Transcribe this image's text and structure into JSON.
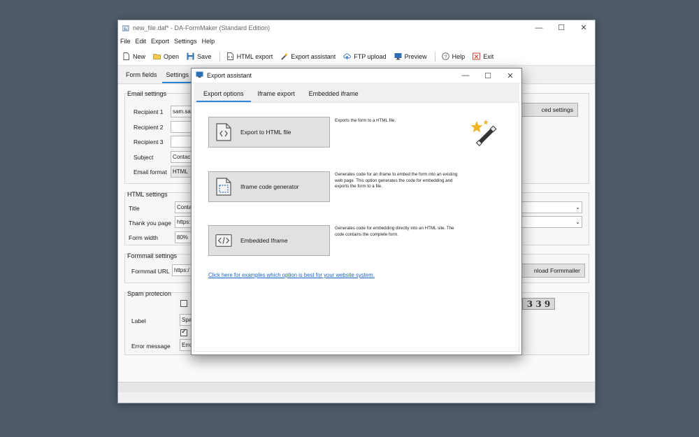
{
  "window": {
    "title": "new_file.daf* - DA-FormMaker (Standard Edition)",
    "minimize": "—",
    "maximize": "☐",
    "close": "✕"
  },
  "menu": [
    "File",
    "Edit",
    "Export",
    "Settings",
    "Help"
  ],
  "toolbar": {
    "new": "New",
    "open": "Open",
    "save": "Save",
    "html_export": "HTML export",
    "export_assistant": "Export assistant",
    "ftp_upload": "FTP upload",
    "preview": "Preview",
    "help": "Help",
    "exit": "Exit"
  },
  "main_tabs": [
    "Form fields",
    "Settings"
  ],
  "email_settings": {
    "title": "Email settings",
    "recipient1_label": "Recipient 1",
    "recipient1_value": "sam.sa",
    "recipient2_label": "Recipient 2",
    "recipient3_label": "Recipient 3",
    "subject_label": "Subject",
    "subject_value": "Contac",
    "format_label": "Email format",
    "format_value": "HTML",
    "advanced_button": "ced settings"
  },
  "html_settings": {
    "title": "HTML settings",
    "title_label": "Title",
    "title_value": "Conta",
    "thankyou_label": "Thank you page",
    "thankyou_value": "https:",
    "width_label": "Form width",
    "width_value": "80%"
  },
  "formmail_settings": {
    "title": "Formmail settings",
    "url_label": "Formmail URL",
    "url_value": "https:/",
    "download_button": "nload Formmailer"
  },
  "spam": {
    "title": "Spam protecion",
    "label_label": "Label",
    "label_value": "Spa",
    "error_label": "Error message",
    "error_value": "Erro",
    "captcha_text": "3 3 9"
  },
  "dialog": {
    "title": "Export assistant",
    "tabs": [
      "Export options",
      "Iframe export",
      "Embedded iframe"
    ],
    "options": [
      {
        "label": "Export to HTML file",
        "icon": "code-file-icon",
        "description": "Exports the form to a HTML file."
      },
      {
        "label": "Iframe code generator",
        "icon": "iframe-file-icon",
        "description": "Generates code for an iframe to embed the form into an existing web page. This option generates the code for embedding and exports the form to a file."
      },
      {
        "label": "Embedded Iframe",
        "icon": "code-window-icon",
        "description": "Generates code for embedding directly into an HTML site. The code contains the complete form."
      }
    ],
    "link": "Click here for examples which option is best for your website system."
  },
  "colors": {
    "accent": "#2b85d8",
    "background": "#4e5a68",
    "link": "#1a64c8"
  }
}
